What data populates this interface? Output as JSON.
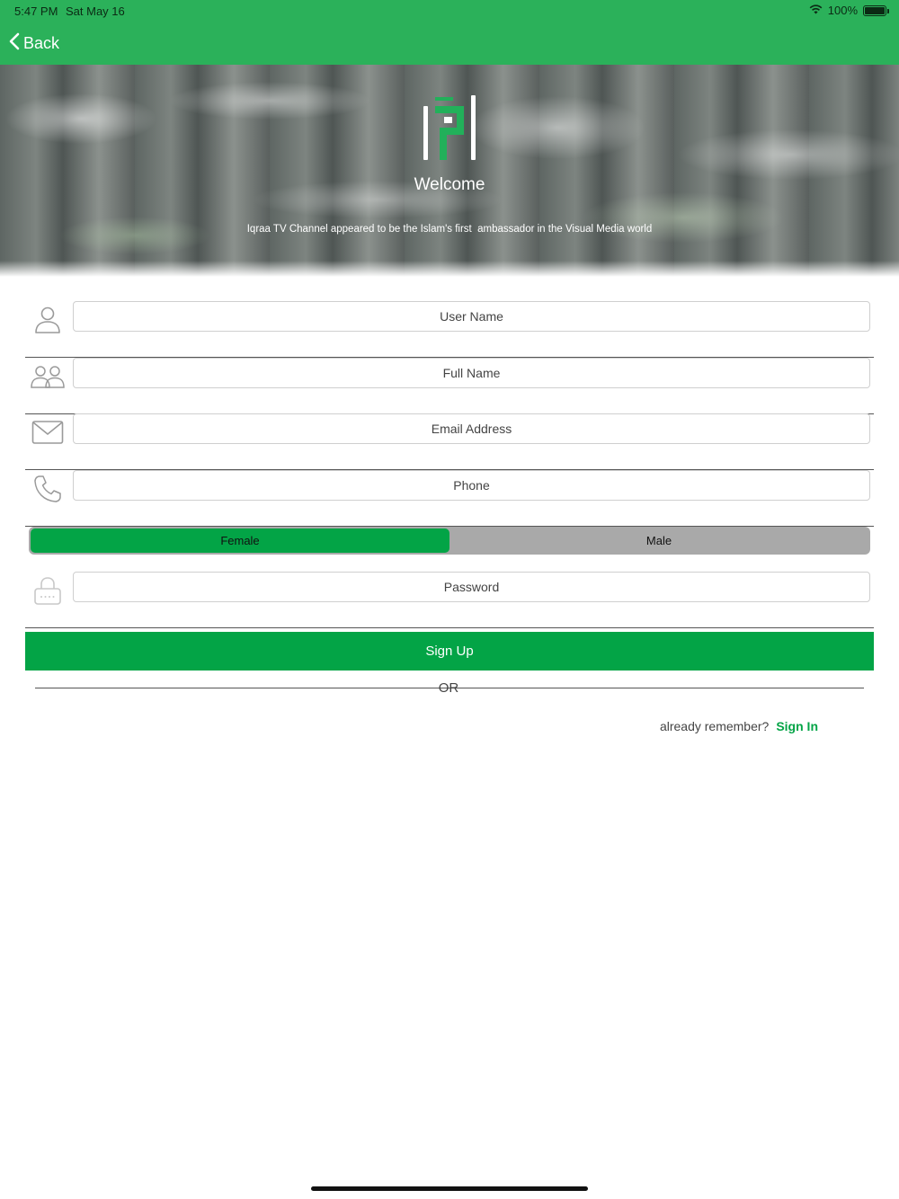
{
  "status_bar": {
    "time": "5:47 PM",
    "date": "Sat May 16",
    "battery": "100%"
  },
  "nav": {
    "back_label": "Back"
  },
  "header": {
    "title": "Welcome",
    "tagline": "Iqraa TV Channel appeared to be the Islam's first  ambassador in the Visual Media world"
  },
  "form": {
    "username_placeholder": "User Name",
    "fullname_placeholder": "Full Name",
    "email_placeholder": "Email Address",
    "phone_placeholder": "Phone",
    "password_placeholder": "Password",
    "gender": {
      "options": [
        "Female",
        "Male"
      ],
      "selected": "Female"
    },
    "submit_label": "Sign Up",
    "separator": "OR",
    "signin_prompt": "already remember?",
    "signin_link": "Sign In"
  },
  "colors": {
    "nav_green": "#2bb15a",
    "accent_green": "#03a446",
    "segment_gray": "#a9a9a9"
  },
  "icons": [
    "chevron-left-icon",
    "wifi-icon",
    "battery-icon",
    "user-icon",
    "users-icon",
    "mail-icon",
    "phone-icon",
    "lock-icon"
  ]
}
